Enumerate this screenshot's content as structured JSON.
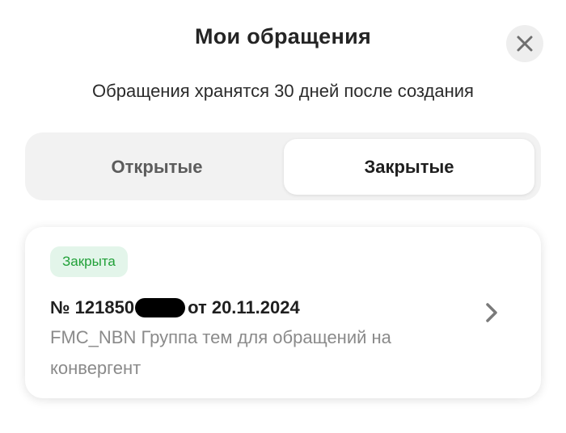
{
  "header": {
    "title": "Мои обращения",
    "close_icon": "close-icon"
  },
  "info": {
    "retention_note": "Обращения хранятся 30 дней после создания"
  },
  "tabs": [
    {
      "label": "Открытые",
      "selected": false
    },
    {
      "label": "Закрытые",
      "selected": true
    }
  ],
  "requests": [
    {
      "status": "Закрыта",
      "number_prefix": "№ 121850",
      "date_text": "от 20.11.2024",
      "topic": "FMC_NBN Группа тем для обращений на конвергент",
      "chevron_icon": "chevron-right-icon"
    }
  ],
  "colors": {
    "accent_green": "#21a038",
    "badge_background": "#e3f5ea",
    "tab_track": "#f2f2f2"
  }
}
